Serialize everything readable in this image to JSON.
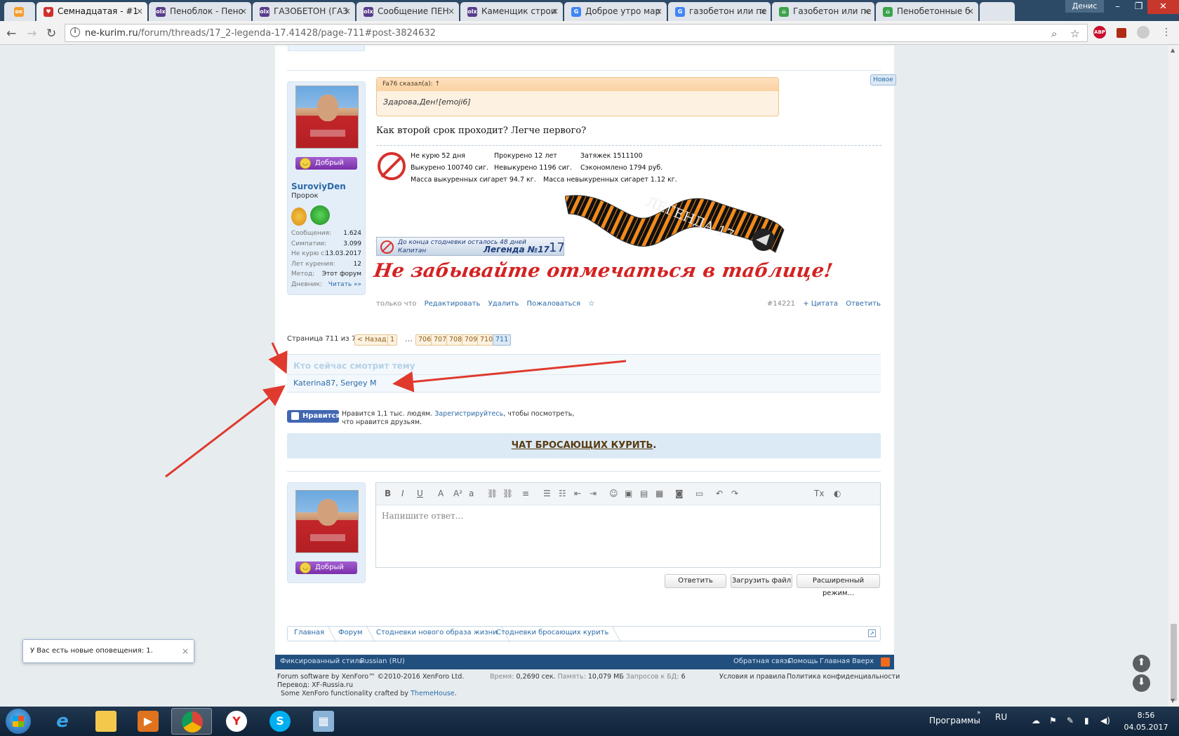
{
  "browser": {
    "tabs": [
      {
        "label": "",
        "favicon": "odnoklassniki-icon",
        "color": "#f59d2a"
      },
      {
        "label": "Семнадцатая - #1",
        "favicon": "forum-shield-icon",
        "color": "#d0312d"
      },
      {
        "label": "Пеноблок - Пено",
        "favicon": "olx-icon",
        "color": "#5a3c8c"
      },
      {
        "label": "ГАЗОБЕТОН (ГАЗ",
        "favicon": "olx-icon",
        "color": "#5a3c8c"
      },
      {
        "label": "Сообщение ПЕН",
        "favicon": "olx-icon",
        "color": "#5a3c8c"
      },
      {
        "label": "Каменщик строи",
        "favicon": "olx-icon",
        "color": "#5a3c8c"
      },
      {
        "label": "Доброе утро мар",
        "favicon": "google-icon",
        "color": "#4285f4"
      },
      {
        "label": "газобетон или пе",
        "favicon": "google-icon",
        "color": "#4285f4"
      },
      {
        "label": "Газобетон или пе",
        "favicon": "house-icon",
        "color": "#3ba34a"
      },
      {
        "label": "Пенобетонные б",
        "favicon": "house-icon",
        "color": "#3ba34a"
      }
    ],
    "user": "Денис",
    "url_host": "ne-kurim.ru",
    "url_path": "/forum/threads/17_2-legenda-17.41428/page-711#post-3824632",
    "ext_abp_count": "2"
  },
  "post": {
    "new_badge": "Новое",
    "quote_author": "Fa76 сказал(а): ↑",
    "quote_text": "Здарова,Ден![emoji6]",
    "message": "Как второй срок проходит? Легче первого?",
    "counter": {
      "not_smoking": "Не курю 52 дня",
      "wasted": "Прокурено 12 лет",
      "puffs": "Затяжек 1511100",
      "smoked": "Выкурено 100740 сиг.",
      "not_smoked": "Невыкурено 1196 сиг.",
      "saved": "Сэкономлено 1794 руб.",
      "mass_smoked": "Масса выкуренных сигарет 94.7 кг.",
      "mass_not_smoked": "Масса невыкуренных сигарет 1.12 кг."
    },
    "ribbon_text": "ЛЕГЕНДА 17",
    "banner": {
      "line1": "До конца стодневки осталось 48 дней",
      "line2": "Капитан",
      "line3": "Легенда №17",
      "num": "17"
    },
    "reminder": "Не забывайте отмечаться в таблице!",
    "time": "только что",
    "actions": [
      "Редактировать",
      "Удалить",
      "Пожаловаться",
      "☆"
    ],
    "post_number": "#14221",
    "quote_action": "+ Цитата",
    "reply_action": "Ответить"
  },
  "author": {
    "name": "SuroviyDen",
    "title": "Пророк",
    "mood": "Добрый",
    "stats": [
      {
        "k": "Сообщения:",
        "v": "1.624"
      },
      {
        "k": "Симпатии:",
        "v": "3.099"
      },
      {
        "k": "Не курю с:",
        "v": "13.03.2017"
      },
      {
        "k": "Лет курения:",
        "v": "12"
      },
      {
        "k": "Метод:",
        "v": "Этот форум"
      },
      {
        "k": "Дневник:",
        "v": "Читать »»"
      }
    ]
  },
  "pagination": {
    "label": "Страница 711 из 711",
    "back": "< Назад",
    "pages": [
      "1",
      "706",
      "707",
      "708",
      "709",
      "710",
      "711"
    ],
    "gap": "…"
  },
  "viewers": {
    "heading": "Кто сейчас смотрит тему",
    "names": "Katerina87, Sergey M"
  },
  "facebook": {
    "button": "Нравится",
    "text1": "Нравится 1,1 тыс. людям.",
    "link": "Зарегистрируйтесь",
    "text2": ", чтобы посмотреть,",
    "text3": "что нравится друзьям."
  },
  "chat": {
    "link": "ЧАТ БРОСАЮЩИХ КУРИТЬ",
    "dot": "."
  },
  "editor": {
    "placeholder": "Напишите ответ...",
    "reply_button": "Ответить",
    "upload_button": "Загрузить файл",
    "advanced_button": "Расширенный режим..."
  },
  "breadcrumbs": [
    "Главная",
    "Форум",
    "Стодневки нового образа жизни",
    "Стодневки бросающих курить"
  ],
  "footer": {
    "style": "Фиксированный стиль",
    "lang": "Russian (RU)",
    "links": [
      "Обратная связь",
      "Помощь",
      "Главная",
      "Вверх"
    ],
    "software": "Forum software by XenForo™ ©2010-2016 XenForo Ltd.",
    "translation": "Перевод: XF-Russia.ru",
    "theme": "Some XenForo functionality crafted by",
    "theme_link": "ThemeHouse",
    "time_label": "Время:",
    "time_val": "0,2690 сек.",
    "mem_label": "Память:",
    "mem_val": "10,079 МБ",
    "queries_label": "Запросов к БД:",
    "queries_val": "6",
    "terms": "Условия и правила",
    "privacy": "Политика конфиденциальности"
  },
  "notification": "У Вас есть новые оповещения: 1.",
  "taskbar": {
    "programs": "Программы",
    "lang": "RU",
    "time": "8:56",
    "date": "04.05.2017"
  },
  "colors": {
    "accent": "#2b6aa8",
    "footer": "#214f7e",
    "arrow": "#e03a2f"
  }
}
